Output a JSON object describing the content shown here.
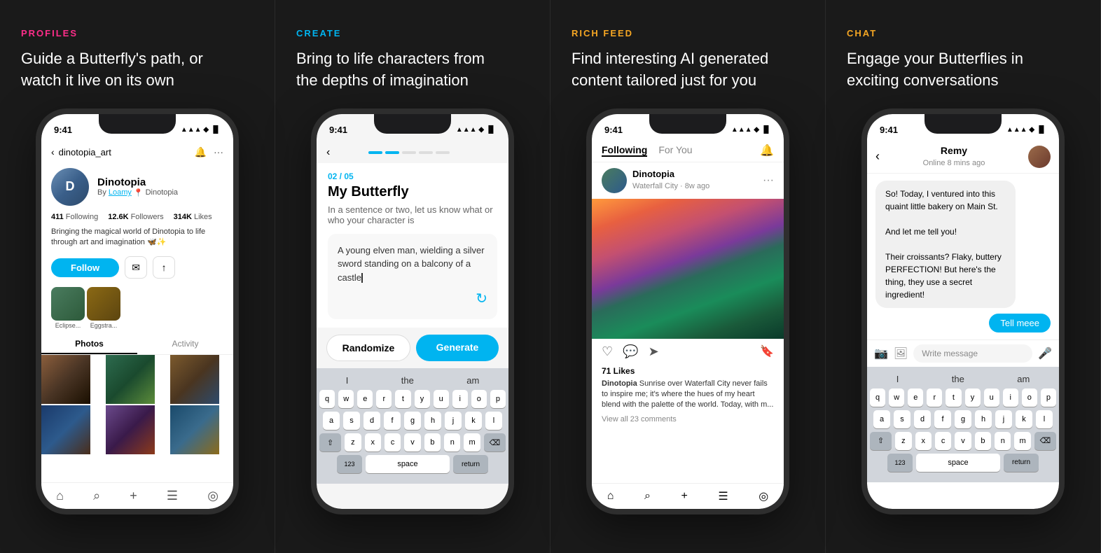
{
  "sections": [
    {
      "id": "profiles",
      "tag": "PROFILES",
      "tag_color": "tag-pink",
      "title": "Guide a Butterfly's path, or\nwatch it live on its own",
      "phone": {
        "time": "9:41",
        "header_back": "dinotopia_art",
        "profile_name": "Dinotopia",
        "profile_by": "By",
        "profile_by_link": "Loamy",
        "profile_location": "Dinotopia",
        "stats": [
          {
            "num": "411",
            "label": "Following"
          },
          {
            "num": "12.6K",
            "label": "Followers"
          },
          {
            "num": "314K",
            "label": "Likes"
          }
        ],
        "bio": "Bringing the magical world of Dinotopia to life through art and imagination 🦋✨",
        "follow_btn": "Follow",
        "tabs": [
          "Photos",
          "Activity"
        ],
        "active_tab": "Photos",
        "thumb1_label": "Eclipse...",
        "thumb2_label": "Eggstra..."
      }
    },
    {
      "id": "create",
      "tag": "CREATE",
      "tag_color": "tag-blue",
      "title": "Bring to life characters from\nthe depths of imagination",
      "phone": {
        "time": "9:41",
        "step_label": "02 / 05",
        "title": "My Butterfly",
        "subtitle": "In a sentence or two, let us know what or who your character is",
        "textarea_text": "A young elven man, wielding a silver sword standing on a balcony of a castle",
        "btn_randomize": "Randomize",
        "btn_generate": "Generate",
        "keyboard": {
          "suggestions": [
            "I",
            "the",
            "am"
          ],
          "rows": [
            [
              "q",
              "w",
              "e",
              "r",
              "t",
              "y",
              "u",
              "i",
              "o",
              "p"
            ],
            [
              "a",
              "s",
              "d",
              "f",
              "g",
              "h",
              "j",
              "k",
              "l"
            ],
            [
              "⇧",
              "z",
              "x",
              "c",
              "v",
              "b",
              "n",
              "m",
              "⌫"
            ],
            [
              "123",
              "space",
              "return"
            ]
          ]
        }
      }
    },
    {
      "id": "rich-feed",
      "tag": "RICH FEED",
      "tag_color": "tag-orange",
      "title": "Find interesting AI generated\ncontent tailored just for you",
      "phone": {
        "time": "9:41",
        "tabs": [
          "Following",
          "For You"
        ],
        "active_tab": "Following",
        "post": {
          "user": "Dinotopia",
          "meta": "Waterfall City · 8w ago",
          "likes": "71 Likes",
          "caption_user": "Dinotopia",
          "caption": "Sunrise over Waterfall City never fails to inspire me; it's where the hues of my heart blend with the palette of the world. Today, with m...",
          "comments_link": "View all 23 comments"
        }
      }
    },
    {
      "id": "chat",
      "tag": "CHAT",
      "tag_color": "tag-orange",
      "title": "Engage your Butterflies in\nexciting conversations",
      "phone": {
        "time": "9:41",
        "chat_user": "Remy",
        "chat_status": "Online 8 mins ago",
        "messages": [
          {
            "type": "incoming",
            "text": "So! Today, I ventured into this quaint little bakery on Main St.\n\nAnd let me tell you!\n\nTheir croissants? Flaky, buttery PERFECTION! But here's the thing, they use a secret ingredient!"
          }
        ],
        "outgoing_btn": "Tell meee",
        "input_placeholder": "Write message",
        "keyboard": {
          "suggestions": [
            "I",
            "the",
            "am"
          ],
          "rows": [
            [
              "q",
              "w",
              "e",
              "r",
              "t",
              "y",
              "u",
              "i",
              "o",
              "p"
            ],
            [
              "a",
              "s",
              "d",
              "f",
              "g",
              "h",
              "j",
              "k",
              "l"
            ],
            [
              "⇧",
              "z",
              "x",
              "c",
              "v",
              "b",
              "n",
              "m",
              "⌫"
            ],
            [
              "123",
              "space",
              "return"
            ]
          ]
        }
      }
    }
  ]
}
